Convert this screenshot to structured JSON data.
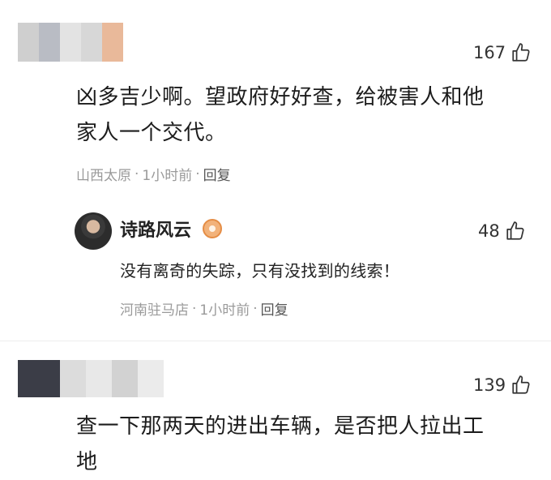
{
  "comments": [
    {
      "likes": "167",
      "text_line1": "凶多吉少啊。望政府好好查，给被害人和他",
      "text_line2": "家人一个交代。",
      "location": "山西太原",
      "time": "1小时前",
      "reply_label": "回复",
      "reply": {
        "username": "诗路风云",
        "likes": "48",
        "text": "没有离奇的失踪，只有没找到的线索！",
        "location": "河南驻马店",
        "time": "1小时前",
        "reply_label": "回复"
      }
    },
    {
      "likes": "139",
      "text_line1": "查一下那两天的进出车辆，是否把人拉出工",
      "text_line2": "地"
    }
  ],
  "icons": {
    "like": "thumbs-up-icon",
    "badge": "medal-icon"
  },
  "colors": {
    "meta": "#9a9a9a",
    "text": "#1c1c1c",
    "badge": "#f2b27a"
  }
}
